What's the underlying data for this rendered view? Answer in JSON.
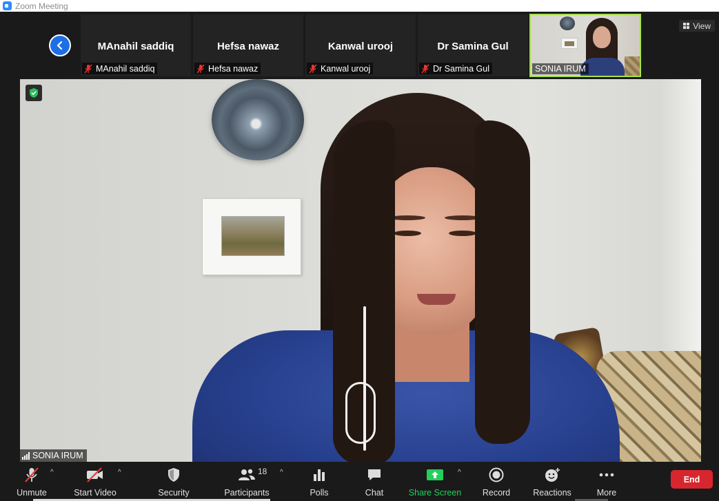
{
  "window": {
    "title": "Zoom Meeting"
  },
  "header": {
    "view_label": "View"
  },
  "participants_strip": [
    {
      "name": "MAnahil saddiq",
      "label": "MAnahil saddiq"
    },
    {
      "name": "Hefsa nawaz",
      "label": "Hefsa nawaz"
    },
    {
      "name": "Kanwal urooj",
      "label": "Kanwal urooj"
    },
    {
      "name": "Dr Samina Gul",
      "label": "Dr Samina Gul"
    }
  ],
  "active_speaker_tile": {
    "label": "SONIA IRUM"
  },
  "main_video": {
    "speaker_label": "SONIA IRUM"
  },
  "toolbar": {
    "unmute": "Unmute",
    "start_video": "Start Video",
    "security": "Security",
    "participants": "Participants",
    "participants_count": "18",
    "polls": "Polls",
    "chat": "Chat",
    "share_screen": "Share Screen",
    "record": "Record",
    "reactions": "Reactions",
    "more": "More",
    "end": "End"
  },
  "colors": {
    "accent_blue": "#2d8cff",
    "share_green": "#22d05a",
    "end_red": "#d7262d",
    "active_border": "#a6e14c"
  }
}
